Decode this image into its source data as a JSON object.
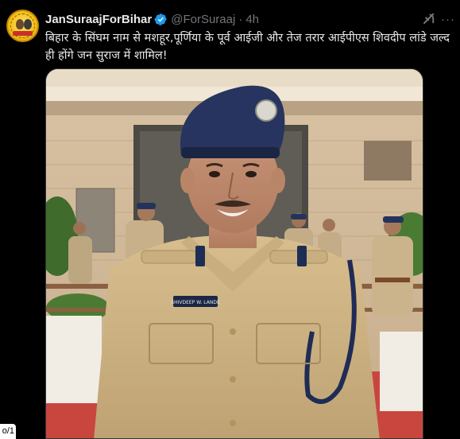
{
  "post": {
    "display_name": "JanSuraajForBihar",
    "handle": "@ForSuraaj",
    "separator": "·",
    "time": "4h",
    "more_label": "···",
    "text": "बिहार के सिंघम नाम से मशहूर,पूर्णिया के पूर्व आईजी और तेज तरार आईपीएस शिवदीप लांडे जल्द ही होंगे जन सुराज में शामिल!",
    "nameplate": "SHIVDEEP W. LANDE"
  },
  "pagination_badge": "o/1",
  "colors": {
    "background": "#000000",
    "text": "#e7e9ea",
    "muted": "#71767b",
    "verified": "#1d9bf0"
  },
  "icons": {
    "verified": "verified-badge-icon",
    "grok": "grok-icon",
    "more": "more-icon"
  }
}
